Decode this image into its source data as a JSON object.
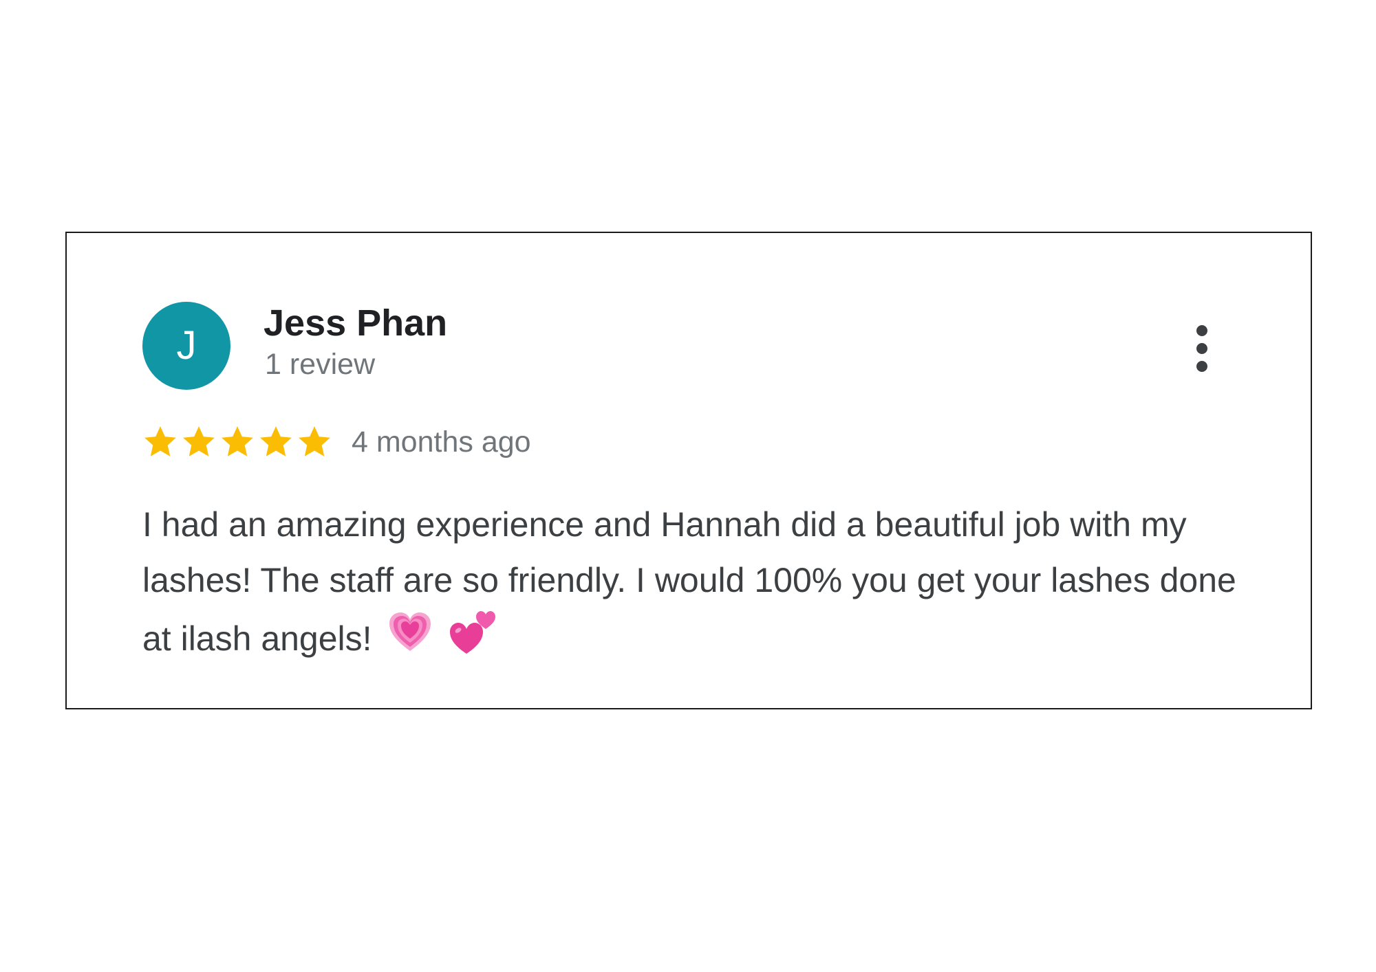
{
  "review": {
    "avatar_letter": "J",
    "avatar_color": "#1196a6",
    "author_name": "Jess Phan",
    "review_count": "1 review",
    "rating": 5,
    "rating_max": 5,
    "star_color": "#fbbc04",
    "time_ago": "4 months ago",
    "text": "I had an amazing experience and Hannah did a beautiful job with my lashes! The staff are so friendly. I would 100% you get your lashes done at ilash angels!",
    "emojis": [
      "growing-heart-icon",
      "two-hearts-icon"
    ],
    "menu_icon": "more-vert-icon"
  }
}
